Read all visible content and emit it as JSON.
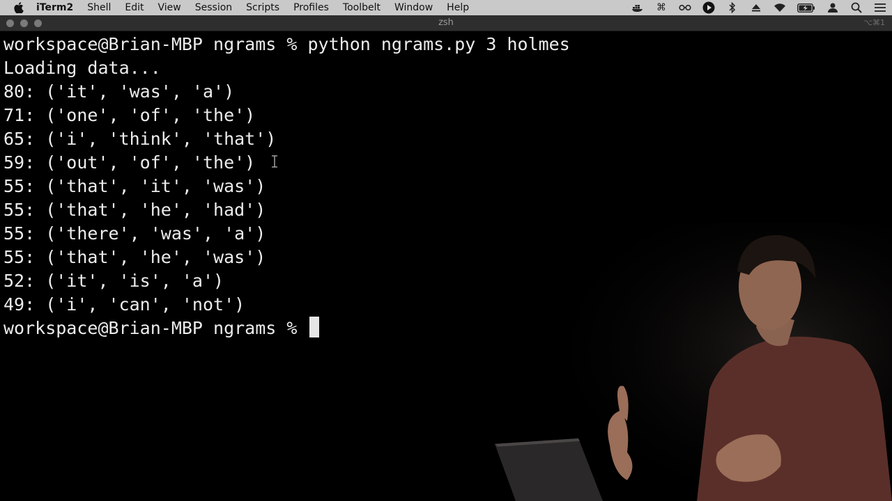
{
  "menubar": {
    "app_name": "iTerm2",
    "items": [
      "Shell",
      "Edit",
      "View",
      "Session",
      "Scripts",
      "Profiles",
      "Toolbelt",
      "Window",
      "Help"
    ],
    "status_icons": [
      "docker-icon",
      "command-icon",
      "glasses-icon",
      "play-circle-icon",
      "bluetooth-icon",
      "eject-icon",
      "wifi-icon",
      "battery-charging-icon",
      "user-icon",
      "search-icon",
      "list-icon"
    ]
  },
  "window": {
    "title": "zsh",
    "shortcut": "⌥⌘1"
  },
  "terminal": {
    "prompt": "workspace@Brian-MBP ngrams % ",
    "command": "python ngrams.py 3 holmes",
    "output": [
      "Loading data...",
      "80: ('it', 'was', 'a')",
      "71: ('one', 'of', 'the')",
      "65: ('i', 'think', 'that')",
      "59: ('out', 'of', 'the')",
      "55: ('that', 'it', 'was')",
      "55: ('that', 'he', 'had')",
      "55: ('there', 'was', 'a')",
      "55: ('that', 'he', 'was')",
      "52: ('it', 'is', 'a')",
      "49: ('i', 'can', 'not')"
    ],
    "final_prompt": "workspace@Brian-MBP ngrams % "
  }
}
